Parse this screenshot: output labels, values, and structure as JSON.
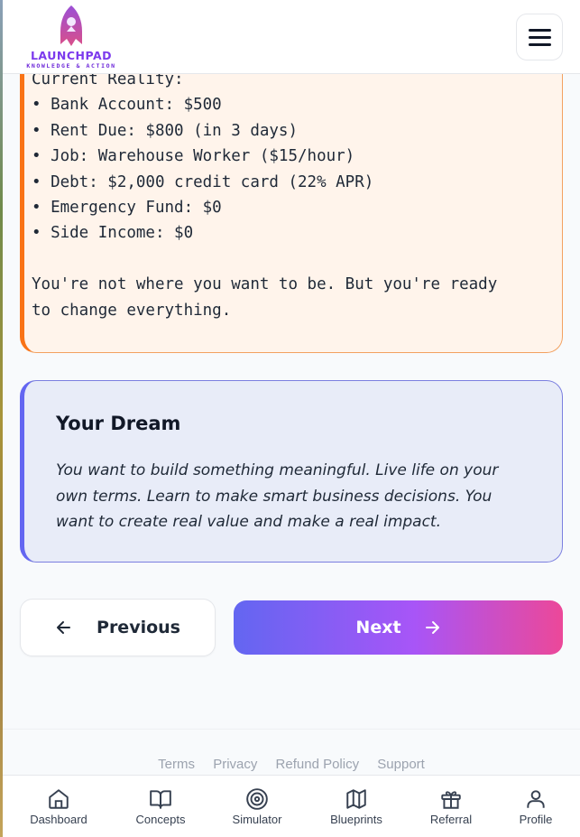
{
  "header": {
    "logo_title": "LAUNCHPAD",
    "logo_subtitle": "KNOWLEDGE & ACTION",
    "menu_icon": "hamburger-menu-icon"
  },
  "reality": {
    "text": "Current Reality:\n• Bank Account: $500\n• Rent Due: $800 (in 3 days)\n• Job: Warehouse Worker ($15/hour)\n• Debt: $2,000 credit card (22% APR)\n• Emergency Fund: $0\n• Side Income: $0\n\nYou're not where you want to be. But you're ready\nto change everything.",
    "accent_color": "#f97316"
  },
  "dream": {
    "title": "Your Dream",
    "text": "You want to build something meaningful. Live life on your own terms. Learn to make smart business decisions. You want to create real value and make a real impact.",
    "accent_color": "#6366f1"
  },
  "navigation": {
    "previous_label": "Previous",
    "next_label": "Next",
    "previous_icon": "arrow-left-icon",
    "next_icon": "arrow-right-icon"
  },
  "footer": {
    "links": [
      "Terms",
      "Privacy",
      "Refund Policy",
      "Support"
    ]
  },
  "bottom_nav": {
    "items": [
      {
        "label": "Dashboard",
        "icon": "home-icon"
      },
      {
        "label": "Concepts",
        "icon": "book-icon"
      },
      {
        "label": "Simulator",
        "icon": "target-icon"
      },
      {
        "label": "Blueprints",
        "icon": "map-icon"
      },
      {
        "label": "Referral",
        "icon": "gift-icon"
      },
      {
        "label": "Profile",
        "icon": "user-icon"
      }
    ]
  }
}
